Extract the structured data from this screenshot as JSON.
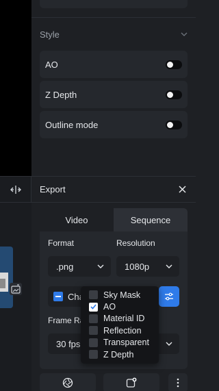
{
  "style_section": {
    "title": "Style",
    "toggles": [
      {
        "label": "AO",
        "on": false
      },
      {
        "label": "Z Depth",
        "on": false
      },
      {
        "label": "Outline mode",
        "on": false
      }
    ]
  },
  "export": {
    "title": "Export",
    "tabs": [
      {
        "label": "Video",
        "active": false
      },
      {
        "label": "Sequence",
        "active": true
      }
    ],
    "format_label": "Format",
    "format_value": ".png",
    "resolution_label": "Resolution",
    "resolution_value": "1080p",
    "channels_text": "Cha",
    "frame_rate_label": "Frame Ra",
    "frame_rate_value": "30 fps",
    "channel_options": [
      {
        "label": "Sky Mask",
        "checked": false
      },
      {
        "label": "AO",
        "checked": true
      },
      {
        "label": "Material ID",
        "checked": false
      },
      {
        "label": "Reflection",
        "checked": false
      },
      {
        "label": "Transparent",
        "checked": false
      },
      {
        "label": "Z Depth",
        "checked": false
      }
    ]
  },
  "colors": {
    "accent": "#2f7be9",
    "panel_bg": "#1e2024",
    "card_bg": "#25282d"
  }
}
